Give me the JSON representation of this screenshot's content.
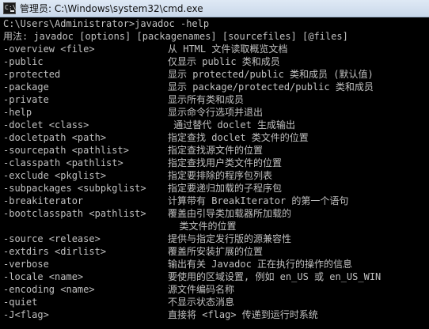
{
  "window": {
    "title": "管理员: C:\\Windows\\system32\\cmd.exe",
    "icon": "cmd-icon",
    "icon_prompt": "C:\\"
  },
  "console": {
    "command_line": "C:\\Users\\Administrator>javadoc -help",
    "usage_line": "用法: javadoc [options] [packagenames] [sourcefiles] [@files]",
    "options": [
      {
        "opt": "-overview <file>",
        "desc": "从 HTML 文件读取概览文档"
      },
      {
        "opt": "-public",
        "desc": "仅显示 public 类和成员"
      },
      {
        "opt": "-protected",
        "desc": "显示 protected/public 类和成员 (默认值)"
      },
      {
        "opt": "-package",
        "desc": "显示 package/protected/public 类和成员"
      },
      {
        "opt": "-private",
        "desc": "显示所有类和成员"
      },
      {
        "opt": "-help",
        "desc": "显示命令行选项并退出"
      },
      {
        "opt": "-doclet <class>",
        "desc": " 通过替代 doclet 生成输出"
      },
      {
        "opt": "-docletpath <path>",
        "desc": "指定查找 doclet 类文件的位置"
      },
      {
        "opt": "-sourcepath <pathlist>",
        "desc": "指定查找源文件的位置"
      },
      {
        "opt": "-classpath <pathlist>",
        "desc": "指定查找用户类文件的位置"
      },
      {
        "opt": "-exclude <pkglist>",
        "desc": "指定要排除的程序包列表"
      },
      {
        "opt": "-subpackages <subpkglist>",
        "desc": "指定要递归加载的子程序包"
      },
      {
        "opt": "-breakiterator",
        "desc": "计算带有 BreakIterator 的第一个语句"
      },
      {
        "opt": "-bootclasspath <pathlist>",
        "desc": "覆盖由引导类加载器所加载的"
      },
      {
        "opt": "",
        "desc": "  类文件的位置"
      },
      {
        "opt": "-source <release>",
        "desc": "提供与指定发行版的源兼容性"
      },
      {
        "opt": "-extdirs <dirlist>",
        "desc": "覆盖所安装扩展的位置"
      },
      {
        "opt": "-verbose",
        "desc": "输出有关 Javadoc 正在执行的操作的信息"
      },
      {
        "opt": "-locale <name>",
        "desc": "要使用的区域设置, 例如 en_US 或 en_US_WIN"
      },
      {
        "opt": "-encoding <name>",
        "desc": "源文件编码名称"
      },
      {
        "opt": "-quiet",
        "desc": "不显示状态消息"
      },
      {
        "opt": "-J<flag>",
        "desc": "直接将 <flag> 传递到运行时系统"
      }
    ]
  },
  "colors": {
    "console_bg": "#000000",
    "console_text": "#c0c0c0",
    "titlebar": "#dfe9f5"
  }
}
